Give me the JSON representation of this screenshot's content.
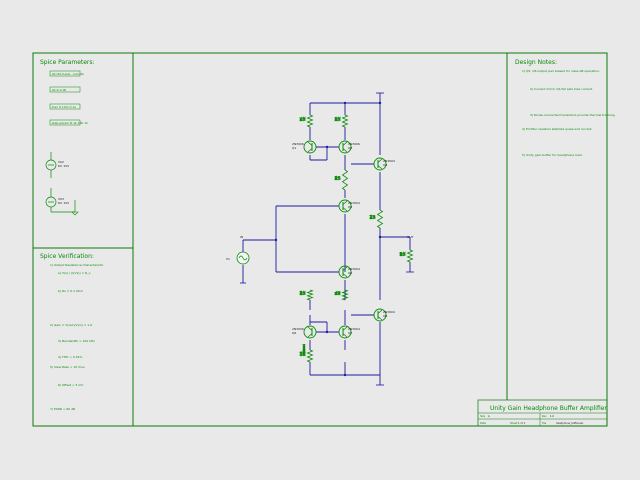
{
  "spice_parameters": {
    "title": "Spice Parameters:",
    "directives": [
      ".lib LM-2.sub, .include",
      ".lib D-2.lib",
      ".tran 0 10m 0 1u",
      ".step param R 1k 10k 1k"
    ],
    "sources": [
      {
        "ref": "V02",
        "value": "DC 15V"
      },
      {
        "ref": "V03",
        "value": "DC 15V"
      }
    ]
  },
  "spice_verification": {
    "title": "Spice Verification:",
    "lines": [
      "1) Output Resistance Characteristic",
      "a) V(o) / (I(V1)) = R_o",
      "b) Ro = 0.1 Ohm",
      "2) Gain = V(out)/V(in) = 1.0",
      "3) Bandwidth > 100 kHz",
      "4) THD < 0.01%",
      "5) Slew Rate > 10 V/us",
      "6) Offset < 5 mV",
      "7) PSRR > 60 dB"
    ]
  },
  "design_notes": {
    "title": "Design Notes:",
    "lines": [
      "1) Q5, Q6 output pair biased for class AB operation.",
      "2) Current mirror Q1/Q2 sets bias current.",
      "3) Diode-connected transistors provide thermal tracking.",
      "4) Emitter resistors stabilize quiescent current.",
      "5) Unity gain buffer for headphone load."
    ]
  },
  "schematic": {
    "components": [
      {
        "ref": "R1",
        "value": "1k"
      },
      {
        "ref": "R2",
        "value": "1k"
      },
      {
        "ref": "Q1",
        "value": "2N3906"
      },
      {
        "ref": "Q2",
        "value": "2N3906"
      },
      {
        "ref": "Q3",
        "value": "2N3904"
      },
      {
        "ref": "Q4",
        "value": "2N3904"
      },
      {
        "ref": "Q5",
        "value": "2N3904"
      },
      {
        "ref": "Q6",
        "value": "2N3906"
      },
      {
        "ref": "Q7",
        "value": "2N3904"
      },
      {
        "ref": "Q8",
        "value": "2N3904"
      },
      {
        "ref": "Q9",
        "value": "2N3904"
      },
      {
        "ref": "R3",
        "value": "10"
      },
      {
        "ref": "R4",
        "value": "10"
      },
      {
        "ref": "R5",
        "value": "1k"
      },
      {
        "ref": "R6",
        "value": "1k"
      },
      {
        "ref": "RL",
        "value": "32"
      },
      {
        "ref": "V1",
        "value": "SINE"
      }
    ],
    "labels": {
      "vin": "IN",
      "vout": "OUT"
    }
  },
  "title_block": {
    "title": "Unity Gain Headphone Buffer Amplifier",
    "size_label": "Size",
    "size": "A",
    "rev_label": "Rev",
    "rev": "1.0",
    "date_label": "Date",
    "sheet_label": "Sheet",
    "sheet": "1 of 1",
    "file_label": "File",
    "file": "headphone_buffer.asc"
  }
}
